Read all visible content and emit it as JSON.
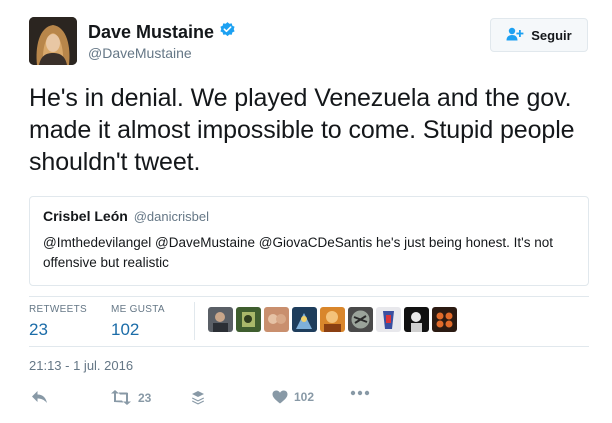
{
  "author": {
    "name": "Dave Mustaine",
    "handle": "@DaveMustaine",
    "verified": true
  },
  "follow_button": {
    "label": "Seguir"
  },
  "tweet": {
    "text": "He's in denial. We played Venezuela and the gov. made it almost impossible to come. Stupid people shouldn't tweet."
  },
  "quoted_tweet": {
    "name": "Crisbel León",
    "handle": "@danicrisbel",
    "text": "@Imthedevilangel @DaveMustaine @GiovaCDeSantis he's just being honest. It's not offensive but realistic"
  },
  "stats": {
    "retweets_label": "RETWEETS",
    "retweets_value": "23",
    "likes_label": "ME GUSTA",
    "likes_value": "102"
  },
  "liker_avatars": [
    "avatar-1",
    "avatar-2",
    "avatar-3",
    "avatar-4",
    "avatar-5",
    "avatar-6",
    "avatar-7",
    "avatar-8",
    "avatar-9"
  ],
  "timestamp": "21:13 - 1 jul. 2016",
  "actions": {
    "reply_icon": "reply-icon",
    "retweet_count": "23",
    "like_count": "102"
  },
  "colors": {
    "accent": "#1b6ca8",
    "verified": "#1da1f2",
    "muted": "#657786",
    "icon": "#8899a6"
  }
}
